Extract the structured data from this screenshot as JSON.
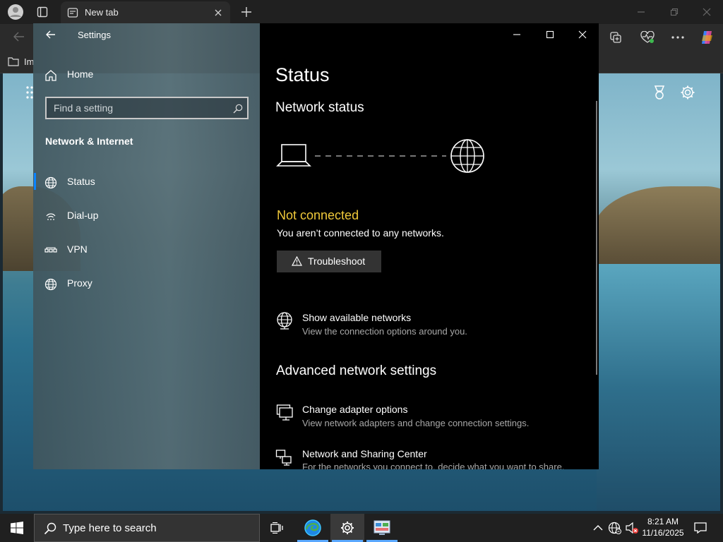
{
  "browser": {
    "tab_title": "New tab",
    "favorites_label": "Im"
  },
  "settings": {
    "window_title": "Settings",
    "home_label": "Home",
    "search_placeholder": "Find a setting",
    "section_title": "Network & Internet",
    "nav_items": [
      {
        "label": "Status",
        "icon": "globe-icon",
        "selected": true
      },
      {
        "label": "Dial-up",
        "icon": "dialup-icon",
        "selected": false
      },
      {
        "label": "VPN",
        "icon": "vpn-icon",
        "selected": false
      },
      {
        "label": "Proxy",
        "icon": "globe-icon",
        "selected": false
      }
    ],
    "content": {
      "page_title": "Status",
      "network_status_heading": "Network status",
      "connection_state": "Not connected",
      "connection_message": "You aren’t connected to any networks.",
      "troubleshoot_label": "Troubleshoot",
      "show_networks_title": "Show available networks",
      "show_networks_desc": "View the connection options around you.",
      "advanced_heading": "Advanced network settings",
      "adapter_title": "Change adapter options",
      "adapter_desc": "View network adapters and change connection settings.",
      "sharing_title": "Network and Sharing Center",
      "sharing_desc": "For the networks you connect to, decide what you want to share."
    }
  },
  "taskbar": {
    "search_placeholder": "Type here to search",
    "time": "8:21 AM",
    "date": "11/16/2025"
  },
  "colors": {
    "accent_blue": "#0a84ff",
    "not_connected_yellow": "#f0c93a",
    "content_bg": "#000000"
  }
}
